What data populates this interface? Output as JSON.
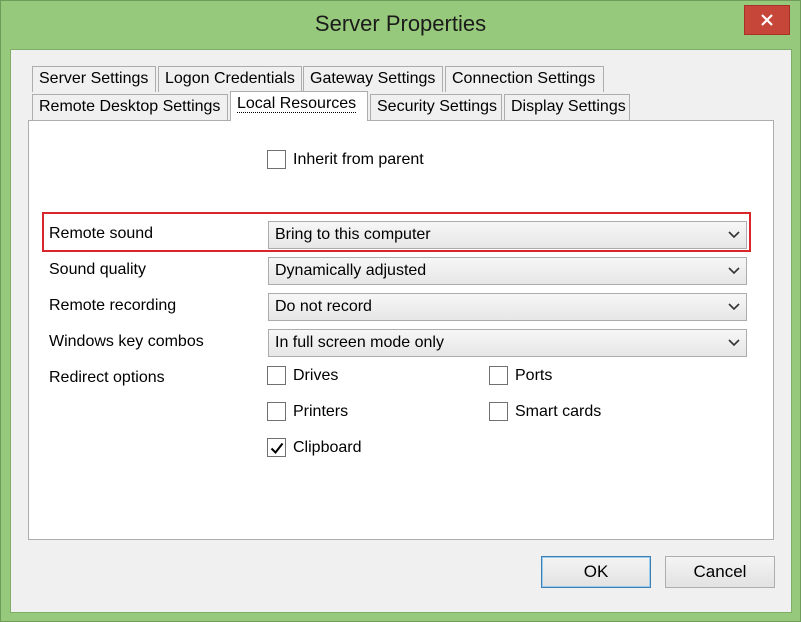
{
  "window": {
    "title": "Server Properties"
  },
  "tabs_row1": [
    {
      "label": "Server Settings"
    },
    {
      "label": "Logon Credentials"
    },
    {
      "label": "Gateway Settings"
    },
    {
      "label": "Connection Settings"
    }
  ],
  "tabs_row2": [
    {
      "label": "Remote Desktop Settings"
    },
    {
      "label": "Local Resources",
      "active": true
    },
    {
      "label": "Security Settings"
    },
    {
      "label": "Display Settings"
    }
  ],
  "panel": {
    "inherit": {
      "label": "Inherit from parent",
      "checked": false
    },
    "remote_sound": {
      "label": "Remote sound",
      "value": "Bring to this computer"
    },
    "sound_quality": {
      "label": "Sound quality",
      "value": "Dynamically adjusted"
    },
    "remote_recording": {
      "label": "Remote recording",
      "value": "Do not record"
    },
    "windows_key_combos": {
      "label": "Windows key combos",
      "value": "In full screen mode only"
    },
    "redirect": {
      "label": "Redirect options",
      "drives": {
        "label": "Drives",
        "checked": false
      },
      "ports": {
        "label": "Ports",
        "checked": false
      },
      "printers": {
        "label": "Printers",
        "checked": false
      },
      "smart_cards": {
        "label": "Smart cards",
        "checked": false
      },
      "clipboard": {
        "label": "Clipboard",
        "checked": true
      }
    }
  },
  "buttons": {
    "ok": "OK",
    "cancel": "Cancel"
  },
  "colors": {
    "frame": "#96c97b",
    "close": "#c7463a",
    "highlight": "#d9262a"
  }
}
